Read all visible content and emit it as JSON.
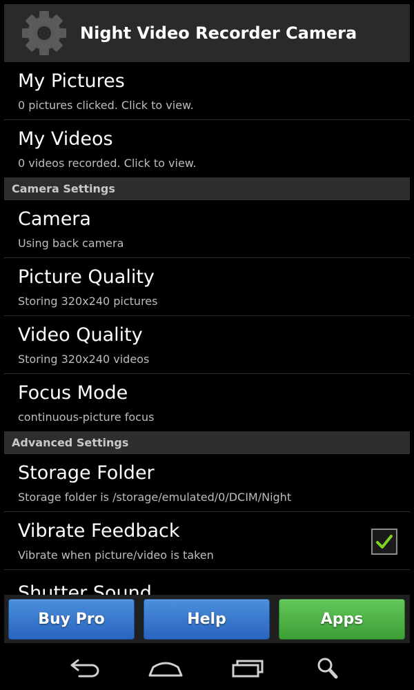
{
  "app": {
    "title": "Night Video Recorder Camera",
    "icon": "gear-icon"
  },
  "items": {
    "pictures": {
      "title": "My Pictures",
      "summary": "0 pictures clicked. Click to view."
    },
    "videos": {
      "title": "My Videos",
      "summary": "0 videos recorded. Click to view."
    },
    "camera": {
      "title": "Camera",
      "summary": "Using back camera"
    },
    "picture_quality": {
      "title": "Picture Quality",
      "summary": "Storing 320x240 pictures"
    },
    "video_quality": {
      "title": "Video Quality",
      "summary": "Storing 320x240 videos"
    },
    "focus_mode": {
      "title": "Focus Mode",
      "summary": "continuous-picture focus"
    },
    "storage_folder": {
      "title": "Storage Folder",
      "summary": "Storage folder is /storage/emulated/0/DCIM/Night"
    },
    "vibrate": {
      "title": "Vibrate Feedback",
      "summary": "Vibrate when picture/video is taken",
      "checked": true
    },
    "shutter": {
      "title": "Shutter Sound"
    }
  },
  "sections": {
    "camera_settings": "Camera Settings",
    "advanced_settings": "Advanced Settings"
  },
  "buttons": {
    "buy_pro": "Buy Pro",
    "help": "Help",
    "apps": "Apps"
  },
  "colors": {
    "blue_button": "#2f6fc8",
    "green_button": "#4caf46",
    "check_mark": "#7ed321"
  },
  "nav_icons": [
    "back-icon",
    "home-icon",
    "recent-apps-icon",
    "search-icon"
  ]
}
